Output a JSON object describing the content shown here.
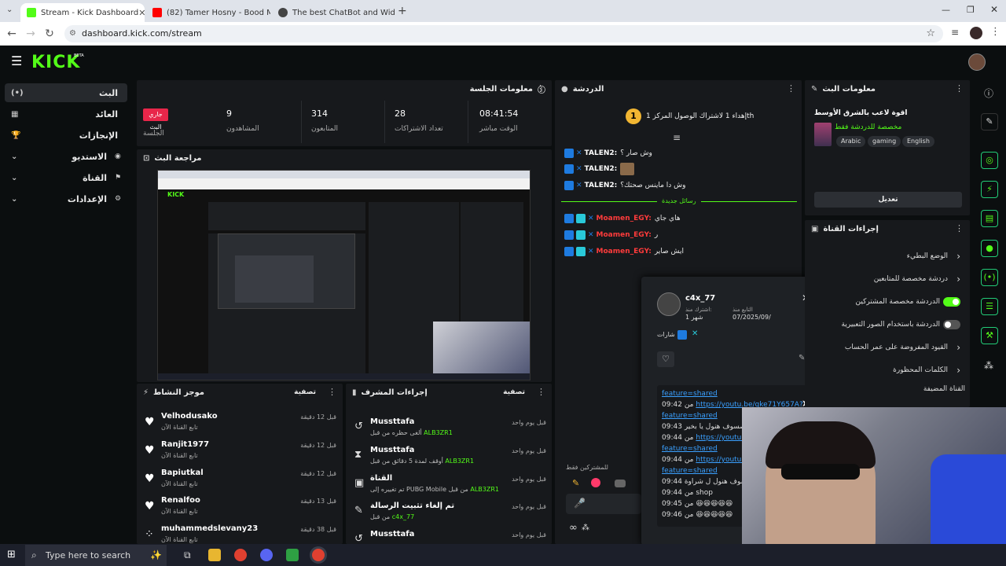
{
  "browser": {
    "tabs": [
      {
        "title": "Stream - Kick Dashboard",
        "icon": "kick-favicon",
        "color": "#53fc18",
        "active": true
      },
      {
        "title": "(82) Tamer Hosny - Bood Moaa",
        "icon": "youtube-favicon",
        "color": "#ff0000",
        "active": false
      },
      {
        "title": "The best ChatBot and Widgets",
        "icon": "botrix-favicon",
        "color": "#444444",
        "active": false
      }
    ],
    "url": "dashboard.kick.com/stream"
  },
  "brand": {
    "logo": "KICK",
    "beta": "BETA",
    "accent": "#53fc18"
  },
  "sidebar": {
    "items": [
      {
        "label": "البث",
        "icon": "broadcast-icon",
        "active": true
      },
      {
        "label": "العائد",
        "icon": "revenue-icon"
      },
      {
        "label": "الإنجازات",
        "icon": "trophy-icon"
      },
      {
        "label": "الاستديو",
        "icon": "chevron-down-icon"
      },
      {
        "label": "القناة",
        "icon": "chevron-down-icon"
      },
      {
        "label": "الإعدادات",
        "icon": "chevron-down-icon"
      }
    ]
  },
  "session": {
    "title": "معلومات الجلسة",
    "live_badge": "جاري البث",
    "live_label": "الجلسة",
    "stats": [
      {
        "value": "9",
        "label": "المشاهدون"
      },
      {
        "value": "314",
        "label": "المتابعون"
      },
      {
        "value": "28",
        "label": "تعداد الاشتراكات"
      },
      {
        "value": "08:41:54",
        "label": "الوقت مباشر"
      }
    ]
  },
  "preview": {
    "title": "مراجعة البث"
  },
  "activity": {
    "title": "موجز النشاط",
    "filter": "تصفية",
    "items": [
      {
        "name": "Velhodusako",
        "sub": "تابع القناة الآن",
        "time": "قبل 12 دقيقة"
      },
      {
        "name": "Ranjit1977",
        "sub": "تابع القناة الآن",
        "time": "قبل 12 دقيقة"
      },
      {
        "name": "Bapiutkal",
        "sub": "تابع القناة الآن",
        "time": "قبل 12 دقيقة"
      },
      {
        "name": "Renalfoo",
        "sub": "تابع القناة الآن",
        "time": "قبل 13 دقيقة"
      },
      {
        "name": "muhammedslevany23",
        "sub": "تابع القناة الآن",
        "time": "قبل 38 دقيقة"
      }
    ]
  },
  "modactions": {
    "title": "إجراءات المشرف",
    "filter": "تصفية",
    "items": [
      {
        "name": "Mussttafa",
        "sub_pre": "ألغى حظره من قبل",
        "sub_user": "ALB3ZR1",
        "time": "قبل يوم واحد",
        "icon": "undo-icon"
      },
      {
        "name": "Mussttafa",
        "sub_pre": "أوقف لمدة 5 دقائق من قبل",
        "sub_user": "ALB3ZR1",
        "time": "قبل يوم واحد",
        "icon": "hourglass-icon"
      },
      {
        "name": "القناة",
        "sub_pre": "تم تغييره إلى PUBG Mobile من قبل",
        "sub_user": "ALB3ZR1",
        "time": "قبل يوم واحد",
        "icon": "channel-icon"
      },
      {
        "name": "تم إلغاء تثبيت الرسالة",
        "sub_pre": "من قبل",
        "sub_user": "c4x_77",
        "time": "قبل يوم واحد",
        "icon": "unpin-icon"
      },
      {
        "name": "Mussttafa",
        "sub_pre": "",
        "sub_user": "",
        "time": "قبل يوم واحد",
        "icon": "undo-icon"
      }
    ]
  },
  "chat": {
    "title": "الدردشة",
    "pinned": "إهداء 1 لاشتراك الوصول المركز 1th",
    "pinned_count": "1",
    "new_messages": "رسائل جديدة",
    "messages": [
      {
        "user": "TALEN2",
        "text": "وش صار ؟",
        "color": "#ffffff"
      },
      {
        "user": "TALEN2",
        "text": "",
        "color": "#ffffff"
      },
      {
        "user": "TALEN2",
        "text": "وش دا ماينس صحتك؟",
        "color": "#ffffff"
      },
      {
        "user": "Moamen_EGY",
        "text": "هاي جاي",
        "color": "#ff3b3b"
      },
      {
        "user": "Moamen_EGY",
        "text": "ر",
        "color": "#ff3b3b"
      },
      {
        "user": "Moamen_EGY",
        "text": "ايش صاير",
        "color": "#ff3b3b"
      }
    ],
    "subs_only": "للمشتركين فقط"
  },
  "popup": {
    "username": "c4x_77",
    "sub_label": "اشترك منذ:",
    "sub_value": "1 شهر",
    "follow_label": "التابع منذ",
    "follow_value": "07/2025/09/",
    "badges_label": "شارات",
    "history": [
      {
        "time": "",
        "text": "feature=shared",
        "link": true
      },
      {
        "time": "09:42",
        "pre": "من",
        "text": "https://youtu.be/qke71Y657A?",
        "link": true
      },
      {
        "time": "",
        "text": "feature=shared",
        "link": true
      },
      {
        "time": "09:43",
        "pre": "",
        "text": "صسوف هنول يا بخير",
        "link": false
      },
      {
        "time": "09:44",
        "pre": "من",
        "text": "https://youtu.b",
        "link": true
      },
      {
        "time": "",
        "text": "feature=shared",
        "link": true
      },
      {
        "time": "09:44",
        "pre": "من",
        "text": "https://youtu.b",
        "link": true
      },
      {
        "time": "",
        "text": "feature=shared",
        "link": true
      },
      {
        "time": "09:44",
        "pre": "",
        "text": "صسوف هنول ل شراوة",
        "link": false
      },
      {
        "time": "09:44",
        "pre": "من",
        "text": "shop",
        "link": false
      },
      {
        "time": "09:45",
        "pre": "من",
        "text": "😆😆😆😆😆",
        "link": false
      },
      {
        "time": "09:46",
        "pre": "من",
        "text": "😆😆😆😆😆",
        "link": false
      }
    ]
  },
  "streaminfo": {
    "title": "معلومات البث",
    "stream_title": "اقوة لاعب بالشرق الأوسط",
    "category": "مخصصة للدردشة فقط",
    "tags": [
      "Arabic",
      "gaming",
      "English"
    ],
    "edit": "تعديل"
  },
  "channelactions": {
    "title": "إجراءات القناة",
    "rows": [
      {
        "label": "الوضع البطيء",
        "control": "chevron"
      },
      {
        "label": "دردشة مخصصة للمتابعين",
        "control": "chevron"
      },
      {
        "label": "الدردشة مخصصة المشتركين",
        "control": "toggle",
        "on": true
      },
      {
        "label": "الدردشة باستخدام الصور التعبيرية",
        "control": "toggle",
        "on": false
      },
      {
        "label": "القيود المفروضة على عمر الحساب",
        "control": "chevron"
      },
      {
        "label": "الكلمات المحظورة",
        "control": "chevron"
      }
    ],
    "footer": "القناة المضيفة"
  },
  "taskbar": {
    "search_placeholder": "Type here to search"
  }
}
